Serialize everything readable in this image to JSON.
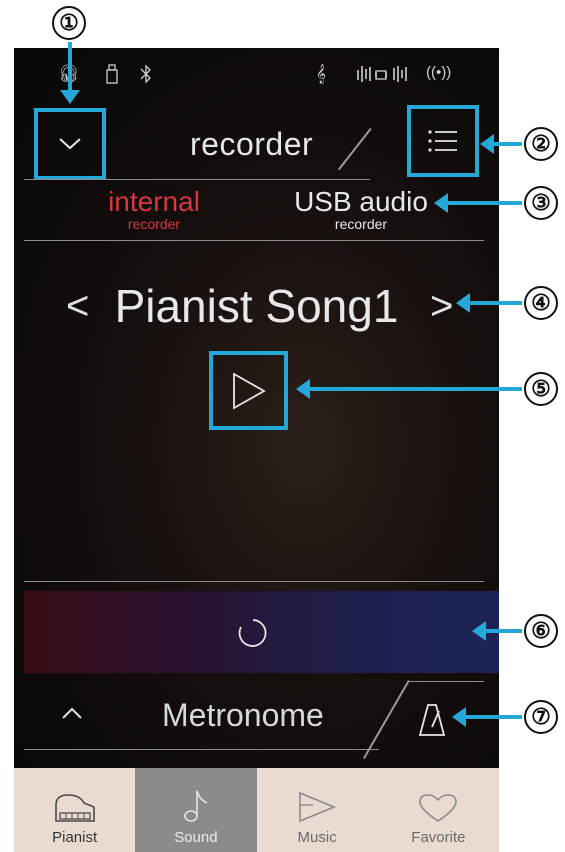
{
  "header": {
    "title": "recorder",
    "collapse_icon": "chevron-down-icon",
    "menu_icon": "list-menu-icon"
  },
  "status_bar": {
    "icons": [
      "headphone-icon",
      "usb-icon",
      "bluetooth-icon",
      "treble-clef-icon",
      "audio-levels-icon",
      "wireless-icon"
    ]
  },
  "recorder_tabs": [
    {
      "label": "internal",
      "sub": "recorder",
      "active": true,
      "color": "#d8363d"
    },
    {
      "label": "USB audio",
      "sub": "recorder",
      "active": false,
      "color": "#e8e8e8"
    }
  ],
  "song": {
    "name": "Pianist Song1",
    "prev": "<",
    "next": ">"
  },
  "metronome": {
    "label": "Metronome",
    "expand": "^"
  },
  "nav": [
    {
      "label": "Pianist",
      "icon": "piano-icon",
      "active": false
    },
    {
      "label": "Sound",
      "icon": "music-note-icon",
      "active": true
    },
    {
      "label": "Music",
      "icon": "play-icon",
      "active": false
    },
    {
      "label": "Favorite",
      "icon": "heart-icon",
      "active": false
    }
  ],
  "callouts": [
    "①",
    "②",
    "③",
    "④",
    "⑤",
    "⑥",
    "⑦"
  ],
  "colors": {
    "accent": "#23a8d8",
    "internal_red": "#d8363d"
  }
}
